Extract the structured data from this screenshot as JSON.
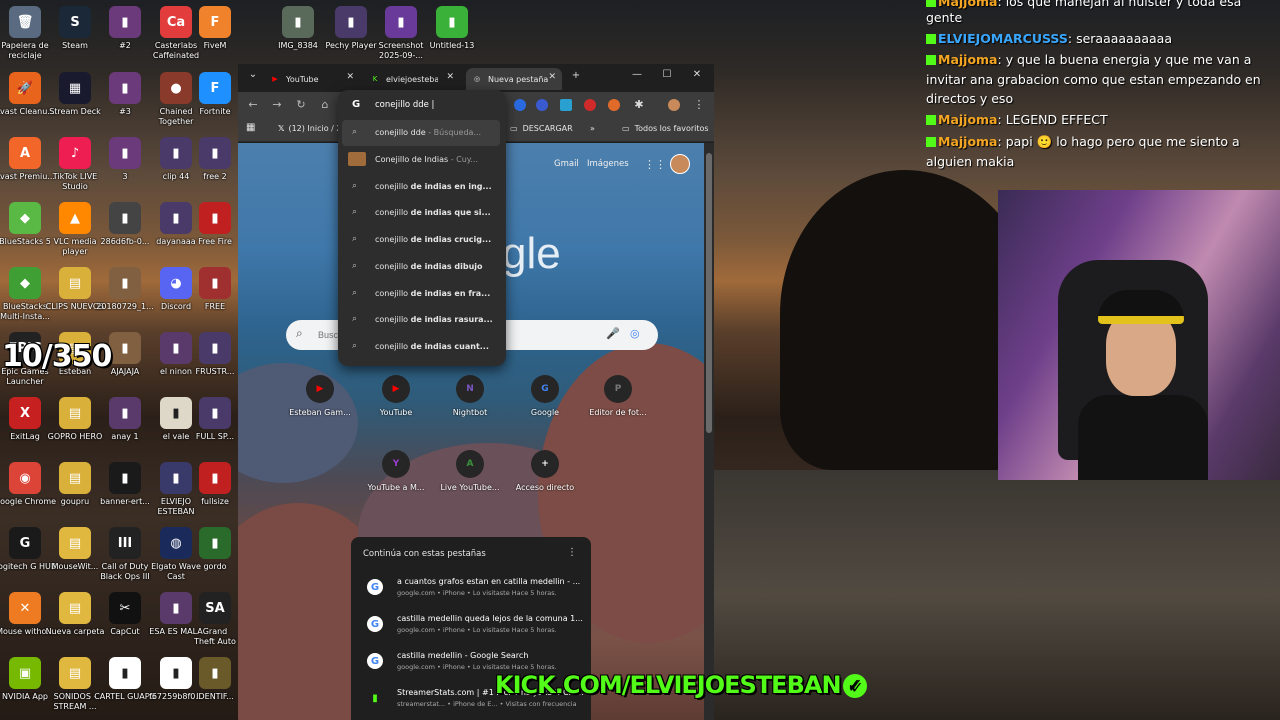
{
  "desktop": {
    "icons": [
      {
        "label": "Papelera de reciclaje",
        "glyph": "🗑",
        "color": "#5a6a80"
      },
      {
        "label": "Avast Cleanu...",
        "glyph": "🚀",
        "color": "#e8631c"
      },
      {
        "label": "Avast Premiu...",
        "glyph": "A",
        "color": "#f2662a"
      },
      {
        "label": "BlueStacks 5",
        "glyph": "◆",
        "color": "#5ab845"
      },
      {
        "label": "BlueStacks Multi-Insta...",
        "glyph": "◆",
        "color": "#3f9f34"
      },
      {
        "label": "Epic Games Launcher",
        "glyph": "EPIC",
        "color": "#222222"
      },
      {
        "label": "ExitLag",
        "glyph": "X",
        "color": "#c72020"
      },
      {
        "label": "Google Chrome",
        "glyph": "◉",
        "color": "#db4437"
      },
      {
        "label": "Logitech G HUB",
        "glyph": "G",
        "color": "#1a1a1a"
      },
      {
        "label": "Mouse witho...",
        "glyph": "✕",
        "color": "#ee7b22"
      },
      {
        "label": "NVIDIA App",
        "glyph": "▣",
        "color": "#76b900"
      },
      {
        "label": "Steam",
        "glyph": "S",
        "color": "#1b2838"
      },
      {
        "label": "Stream Deck",
        "glyph": "▦",
        "color": "#1a1a2e"
      },
      {
        "label": "TikTok LIVE Studio",
        "glyph": "♪",
        "color": "#ee1d52"
      },
      {
        "label": "VLC media player",
        "glyph": "▲",
        "color": "#ff8800"
      },
      {
        "label": "CLIPS NUEVOS",
        "glyph": "▤",
        "color": "#d9b03a"
      },
      {
        "label": "Esteban",
        "glyph": "▤",
        "color": "#d9b03a"
      },
      {
        "label": "GOPRO HERO",
        "glyph": "▤",
        "color": "#d9b03a"
      },
      {
        "label": "goupru",
        "glyph": "▤",
        "color": "#d9b03a"
      },
      {
        "label": "MouseWit...",
        "glyph": "▤",
        "color": "#e0b840"
      },
      {
        "label": "Nueva carpeta",
        "glyph": "▤",
        "color": "#e0b840"
      },
      {
        "label": "SONIDOS - STREAM ...",
        "glyph": "▤",
        "color": "#e0b840"
      },
      {
        "label": "#2",
        "glyph": "▮",
        "color": "#6a3a7a"
      },
      {
        "label": "#3",
        "glyph": "▮",
        "color": "#6a3a7a"
      },
      {
        "label": "3",
        "glyph": "▮",
        "color": "#6a3a7a"
      },
      {
        "label": "286d6fb-0...",
        "glyph": "▮",
        "color": "#444444"
      },
      {
        "label": "20180729_1...",
        "glyph": "▮",
        "color": "#806040"
      },
      {
        "label": "AJAJAJA",
        "glyph": "▮",
        "color": "#806040"
      },
      {
        "label": "anay 1",
        "glyph": "▮",
        "color": "#5a3a6a"
      },
      {
        "label": "banner-ert...",
        "glyph": "▮",
        "color": "#1a1a1a"
      },
      {
        "label": "Call of Duty Black Ops III",
        "glyph": "III",
        "color": "#222222"
      },
      {
        "label": "CapCut",
        "glyph": "✂",
        "color": "#111111"
      },
      {
        "label": "CARTEL GUAPO",
        "glyph": "▮",
        "color": "#ffffff"
      },
      {
        "label": "Casterlabs Caffeinated",
        "glyph": "Ca",
        "color": "#e23c3c"
      },
      {
        "label": "Chained Together",
        "glyph": "●",
        "color": "#8a3a2a"
      },
      {
        "label": "clip 44",
        "glyph": "▮",
        "color": "#4a3a6a"
      },
      {
        "label": "dayanaaa",
        "glyph": "▮",
        "color": "#4a3a6a"
      },
      {
        "label": "Discord",
        "glyph": "◕",
        "color": "#5865f2"
      },
      {
        "label": "el ninon",
        "glyph": "▮",
        "color": "#5a3a6a"
      },
      {
        "label": "el vale",
        "glyph": "▮",
        "color": "#ddd8c8"
      },
      {
        "label": "ELVIEJO ESTEBAN",
        "glyph": "▮",
        "color": "#3a3a6a"
      },
      {
        "label": "Elgato Wave Cast",
        "glyph": "◍",
        "color": "#1a2a5a"
      },
      {
        "label": "ESA ES MALA",
        "glyph": "▮",
        "color": "#5a3a6a"
      },
      {
        "label": "f67259b8f0...",
        "glyph": "▮",
        "color": "#ffffff"
      },
      {
        "label": "FiveM",
        "glyph": "F",
        "color": "#f0822b"
      },
      {
        "label": "Fortnite",
        "glyph": "F",
        "color": "#1e90ff"
      },
      {
        "label": "free 2",
        "glyph": "▮",
        "color": "#4a3a6a"
      },
      {
        "label": "Free Fire",
        "glyph": "▮",
        "color": "#c02020"
      },
      {
        "label": "FREE",
        "glyph": "▮",
        "color": "#a03030"
      },
      {
        "label": "FRUSTR...",
        "glyph": "▮",
        "color": "#4a3a6a"
      },
      {
        "label": "FULL SP...",
        "glyph": "▮",
        "color": "#4a3a6a"
      },
      {
        "label": "fullsize",
        "glyph": "▮",
        "color": "#c02020"
      },
      {
        "label": "gordo",
        "glyph": "▮",
        "color": "#2a6a2a"
      },
      {
        "label": "Grand Theft Auto San",
        "glyph": "SA",
        "color": "#222222"
      },
      {
        "label": "IDENTIF...",
        "glyph": "▮",
        "color": "#6a5a2a"
      },
      {
        "label": "IMG_8384",
        "glyph": "▮",
        "color": "#5a6a5a"
      },
      {
        "label": "Pechy Player",
        "glyph": "▮",
        "color": "#4a3a6a"
      },
      {
        "label": "Screenshot 2025-09-...",
        "glyph": "▮",
        "color": "#6a3a9a"
      },
      {
        "label": "Untitled-13",
        "glyph": "▮",
        "color": "#3ab23a"
      }
    ],
    "counter": "10/350"
  },
  "browser": {
    "tabs": [
      {
        "title": "YouTube",
        "icon": "youtube-icon",
        "icon_color": "#ff0000"
      },
      {
        "title": "elviejoesteban",
        "icon": "kick-icon",
        "icon_color": "#53fc18"
      },
      {
        "title": "Nueva pestaña",
        "icon": "chrome-icon",
        "icon_color": "#dddddd"
      }
    ],
    "new_tab_symbol": "+",
    "window_controls": {
      "minimize": "—",
      "maximize": "☐",
      "close": "✕"
    },
    "bookmarks": {
      "x_label": "(12) Inicio / X",
      "download_label": "DESCARGAR",
      "all_favorites_label": "Todos los favoritos"
    },
    "omnibox": {
      "query": "conejillo dde |",
      "first_query": "conejillo dde",
      "first_query_suffix": "- Búsqueda...",
      "suggestions": [
        {
          "prefix": "Conejillo de Indias",
          "suffix": "- Cuy...",
          "kind": "entity"
        },
        {
          "prefix": "conejillo ",
          "bold": "de indias en ing...",
          "kind": "search"
        },
        {
          "prefix": "conejillo ",
          "bold": "de indias que si...",
          "kind": "search"
        },
        {
          "prefix": "conejillo ",
          "bold": "de indias crucig...",
          "kind": "search"
        },
        {
          "prefix": "conejillo ",
          "bold": "de indias dibujo",
          "kind": "search"
        },
        {
          "prefix": "conejillo ",
          "bold": "de indias en fra...",
          "kind": "search"
        },
        {
          "prefix": "conejillo ",
          "bold": "de indias rasura...",
          "kind": "search"
        },
        {
          "prefix": "conejillo ",
          "bold": "de indias cuant...",
          "kind": "search"
        }
      ]
    },
    "ntp": {
      "gmail": "Gmail",
      "images": "Imágenes",
      "logo": "gle",
      "search_placeholder": "Busc",
      "shortcuts": [
        {
          "label": "Esteban Gam...",
          "letter": "▶",
          "color": "#ff0000"
        },
        {
          "label": "YouTube",
          "letter": "▶",
          "color": "#ff0000"
        },
        {
          "label": "Nightbot",
          "letter": "N",
          "color": "#7a55c2"
        },
        {
          "label": "Google",
          "letter": "G",
          "color": "#4285f4"
        },
        {
          "label": "Editor de fot...",
          "letter": "P",
          "color": "#777777"
        },
        {
          "label": "YouTube a M...",
          "letter": "Y",
          "color": "#9b3dd1"
        },
        {
          "label": "Live YouTube...",
          "letter": "A",
          "color": "#3c8f3c"
        },
        {
          "label": "Acceso directo",
          "letter": "+",
          "color": "#ffffff"
        }
      ],
      "continue_title": "Continúa con estas pestañas",
      "continue_items": [
        {
          "title": "a cuantos grafos estan en catilla medellin - ...",
          "meta": "google.com • iPhone • Lo visitaste Hace 5 horas."
        },
        {
          "title": "castilla medellin queda lejos de la comuna 1...",
          "meta": "google.com • iPhone • Lo visitaste Hace 5 horas."
        },
        {
          "title": "castilla medellin - Google Search",
          "meta": "google.com • iPhone • Lo visitaste Hace 5 horas."
        },
        {
          "title": "StreamerStats.com | #1 Kick Analytics & Cha...",
          "meta": "streamerstat... • iPhone de E... • Visitas con frecuencia"
        }
      ]
    }
  },
  "chat": {
    "messages": [
      {
        "user": "Majjoma",
        "text": "los que manejan al hulster y toda esa",
        "user_class": "nm"
      },
      {
        "user": "",
        "text": "gente",
        "user_class": "nm"
      },
      {
        "user": "ELVIEJOMARCUSSS",
        "text": "seraaaaaaaaaa",
        "user_class": "nm2"
      },
      {
        "user": "Majjoma",
        "text": "y que la buena energia y que me van a",
        "user_class": "nm"
      },
      {
        "user": "",
        "text": "invitar ana grabacion como que estan empezando en",
        "user_class": "nm"
      },
      {
        "user": "",
        "text": "directos y eso",
        "user_class": "nm"
      },
      {
        "user": "Majjoma",
        "text": "LEGEND EFFECT",
        "user_class": "nm"
      },
      {
        "user": "Majjoma",
        "text": "papi 🙂 lo hago pero que me siento a",
        "user_class": "nm"
      },
      {
        "user": "",
        "text": "alguien makia",
        "user_class": "nm"
      }
    ]
  },
  "overlay": {
    "kick_url": "KICK.COM/ELVIEJOESTEBAN",
    "verified": "✓"
  }
}
